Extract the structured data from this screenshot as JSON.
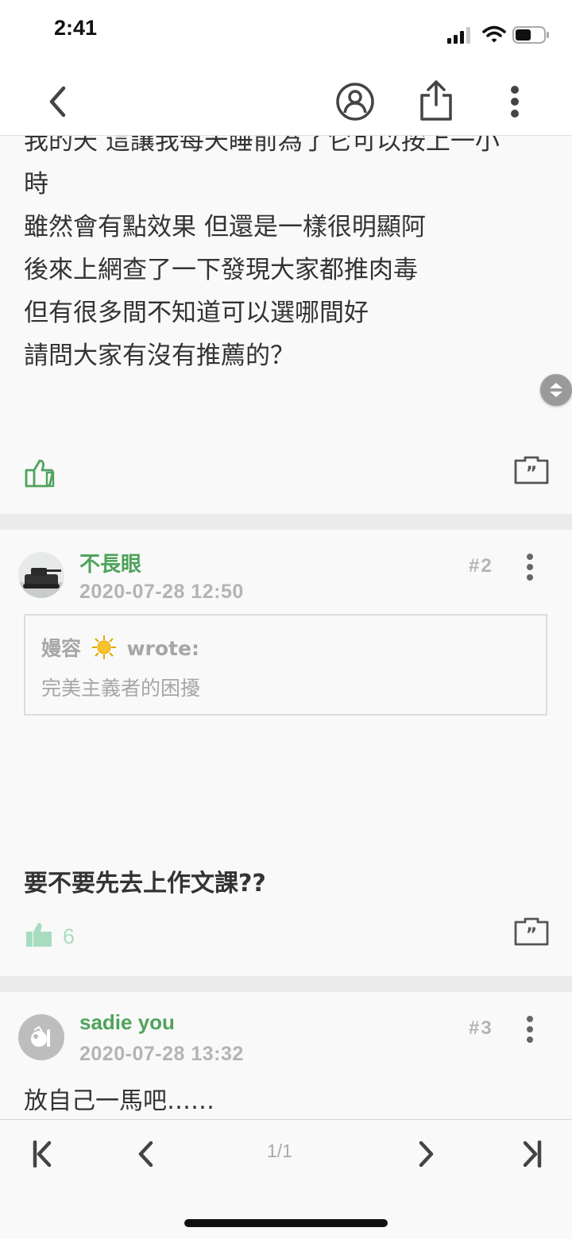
{
  "status_bar": {
    "time": "2:41"
  },
  "post": {
    "lines": [
      "我的天 這讓我每天睡前為了它可以按上一小",
      "時",
      "雖然會有點效果 但還是一樣很明顯阿",
      "後來上網查了一下發現大家都推肉毒",
      "但有很多間不知道可以選哪間好",
      "請問大家有沒有推薦的？"
    ]
  },
  "replies": [
    {
      "username": "不長眼",
      "timestamp": "2020-07-28 12:50",
      "floor": "#2",
      "quote": {
        "author": "嫚容",
        "wrote_label": "wrote:",
        "text": "完美主義者的困擾"
      },
      "text": "要不要先去上作文課??",
      "likes": "6"
    },
    {
      "username": "sadie you",
      "timestamp": "2020-07-28 13:32",
      "floor": "#3",
      "text": "放自己一馬吧……"
    }
  ],
  "pagination": {
    "indicator": "1/1"
  },
  "colors": {
    "accent_green": "#4fa35c",
    "light_green": "#a8dcc0",
    "muted_gray": "#b4b4b4"
  }
}
